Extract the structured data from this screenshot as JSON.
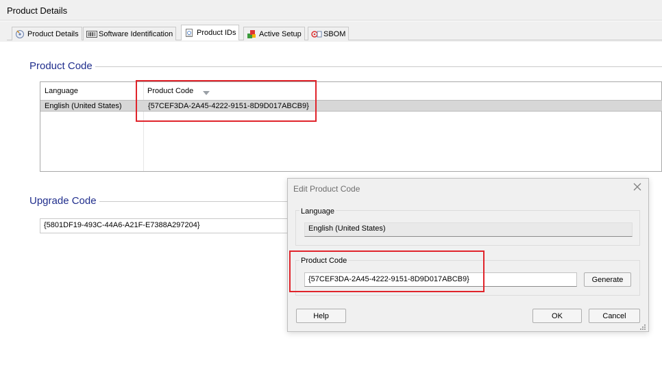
{
  "window": {
    "title": "Product Details"
  },
  "tabs": [
    {
      "label": "Product Details",
      "icon": "product-details-icon"
    },
    {
      "label": "Software Identification",
      "icon": "barcode-icon"
    },
    {
      "label": "Product IDs",
      "icon": "product-ids-icon",
      "active": true
    },
    {
      "label": "Active Setup",
      "icon": "active-setup-icon"
    },
    {
      "label": "SBOM",
      "icon": "sbom-icon"
    }
  ],
  "product_code_section": {
    "title": "Product Code",
    "columns": [
      "Language",
      "Product Code"
    ],
    "rows": [
      {
        "language": "English (United States)",
        "code": "{57CEF3DA-2A45-4222-9151-8D9D017ABCB9}"
      }
    ]
  },
  "upgrade_code_section": {
    "title": "Upgrade Code",
    "value": "{5801DF19-493C-44A6-A21F-E7388A297204}"
  },
  "dialog": {
    "title": "Edit Product Code",
    "language_label": "Language",
    "language_value": "English (United States)",
    "product_code_label": "Product Code",
    "product_code_value": "{57CEF3DA-2A45-4222-9151-8D9D017ABCB9}",
    "generate_label": "Generate",
    "help_label": "Help",
    "ok_label": "OK",
    "cancel_label": "Cancel"
  },
  "colors": {
    "section_title": "#1f2d8c",
    "highlight": "#e0232a",
    "selected_row": "#d7d7d7"
  }
}
